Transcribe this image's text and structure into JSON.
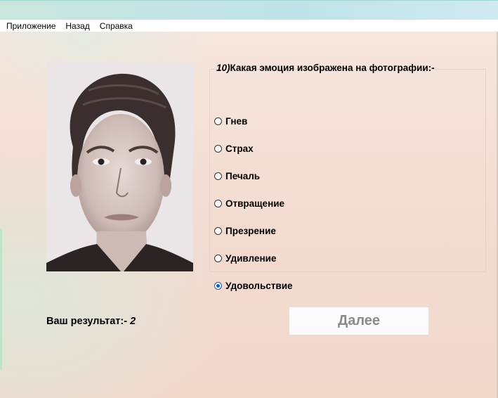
{
  "menu": [
    "Приложение",
    "Назад",
    "Справка"
  ],
  "question": {
    "number": "10)",
    "text": "Какая эмоция изображена на фотографии:-"
  },
  "options": [
    {
      "label": "Гнев",
      "selected": false
    },
    {
      "label": "Страх",
      "selected": false
    },
    {
      "label": "Печаль",
      "selected": false
    },
    {
      "label": "Отвращение",
      "selected": false
    },
    {
      "label": "Презрение",
      "selected": false
    },
    {
      "label": "Удивление",
      "selected": false
    },
    {
      "label": "Удовольствие",
      "selected": true
    }
  ],
  "score": {
    "label": "Ваш результат:-",
    "value": "2"
  },
  "next_button": "Далее",
  "colors": {
    "radio_selected": "#0a5ec6",
    "disabled_text": "#8a8a8a"
  }
}
